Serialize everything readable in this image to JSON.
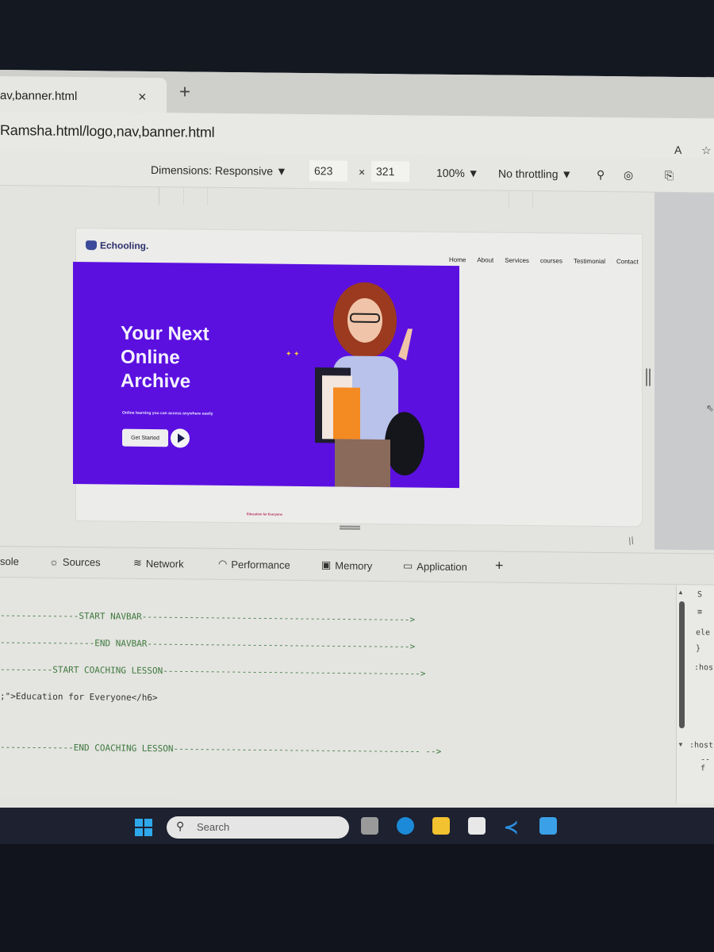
{
  "browser": {
    "tab_title": "av,banner.html",
    "new_tab_label": "+",
    "close_label": "×",
    "url": "Ramsha.html/logo,nav,banner.html",
    "read_aloud_label": "A",
    "favorites_label": "☆"
  },
  "device_toolbar": {
    "dimensions_label": "Dimensions: Responsive ▼",
    "width": "623",
    "times": "×",
    "height": "321",
    "zoom": "100% ▼",
    "throttling": "No throttling ▼"
  },
  "page": {
    "logo_text": "Echooling.",
    "nav": [
      "Home",
      "About",
      "Services",
      "courses",
      "Testimonial",
      "Contact"
    ],
    "headline": "Your Next Online Archive",
    "subline": "Online learning you can access anywhere easily",
    "cta_label": "Get Started",
    "sparkles": "✦ ✦",
    "edu_tag": "Education for Everyone",
    "banner_color": "#5b10e0"
  },
  "devtools": {
    "tabs": [
      {
        "label": "sole",
        "icon": ""
      },
      {
        "label": "Sources",
        "icon": "bug-icon"
      },
      {
        "label": "Network",
        "icon": "wifi-icon"
      },
      {
        "label": "Performance",
        "icon": "gauge-icon"
      },
      {
        "label": "Memory",
        "icon": "chip-icon"
      },
      {
        "label": "Application",
        "icon": "window-icon"
      }
    ],
    "add_tab": "+",
    "code_lines": [
      "---------------START NAVBAR--------------------------------------------------->",
      "------------------END NAVBAR-------------------------------------------------->",
      "----------START COACHING LESSON------------------------------------------------->",
      ";\">Education for Everyone</h6>",
      "--------------END COACHING LESSON----------------------------------------------- -->"
    ],
    "styles_lines": [
      "S",
      "≡",
      "ele",
      "}",
      ":hos",
      "-",
      "--",
      "}",
      ":host",
      "--f"
    ]
  },
  "taskbar": {
    "search_placeholder": "Search"
  }
}
